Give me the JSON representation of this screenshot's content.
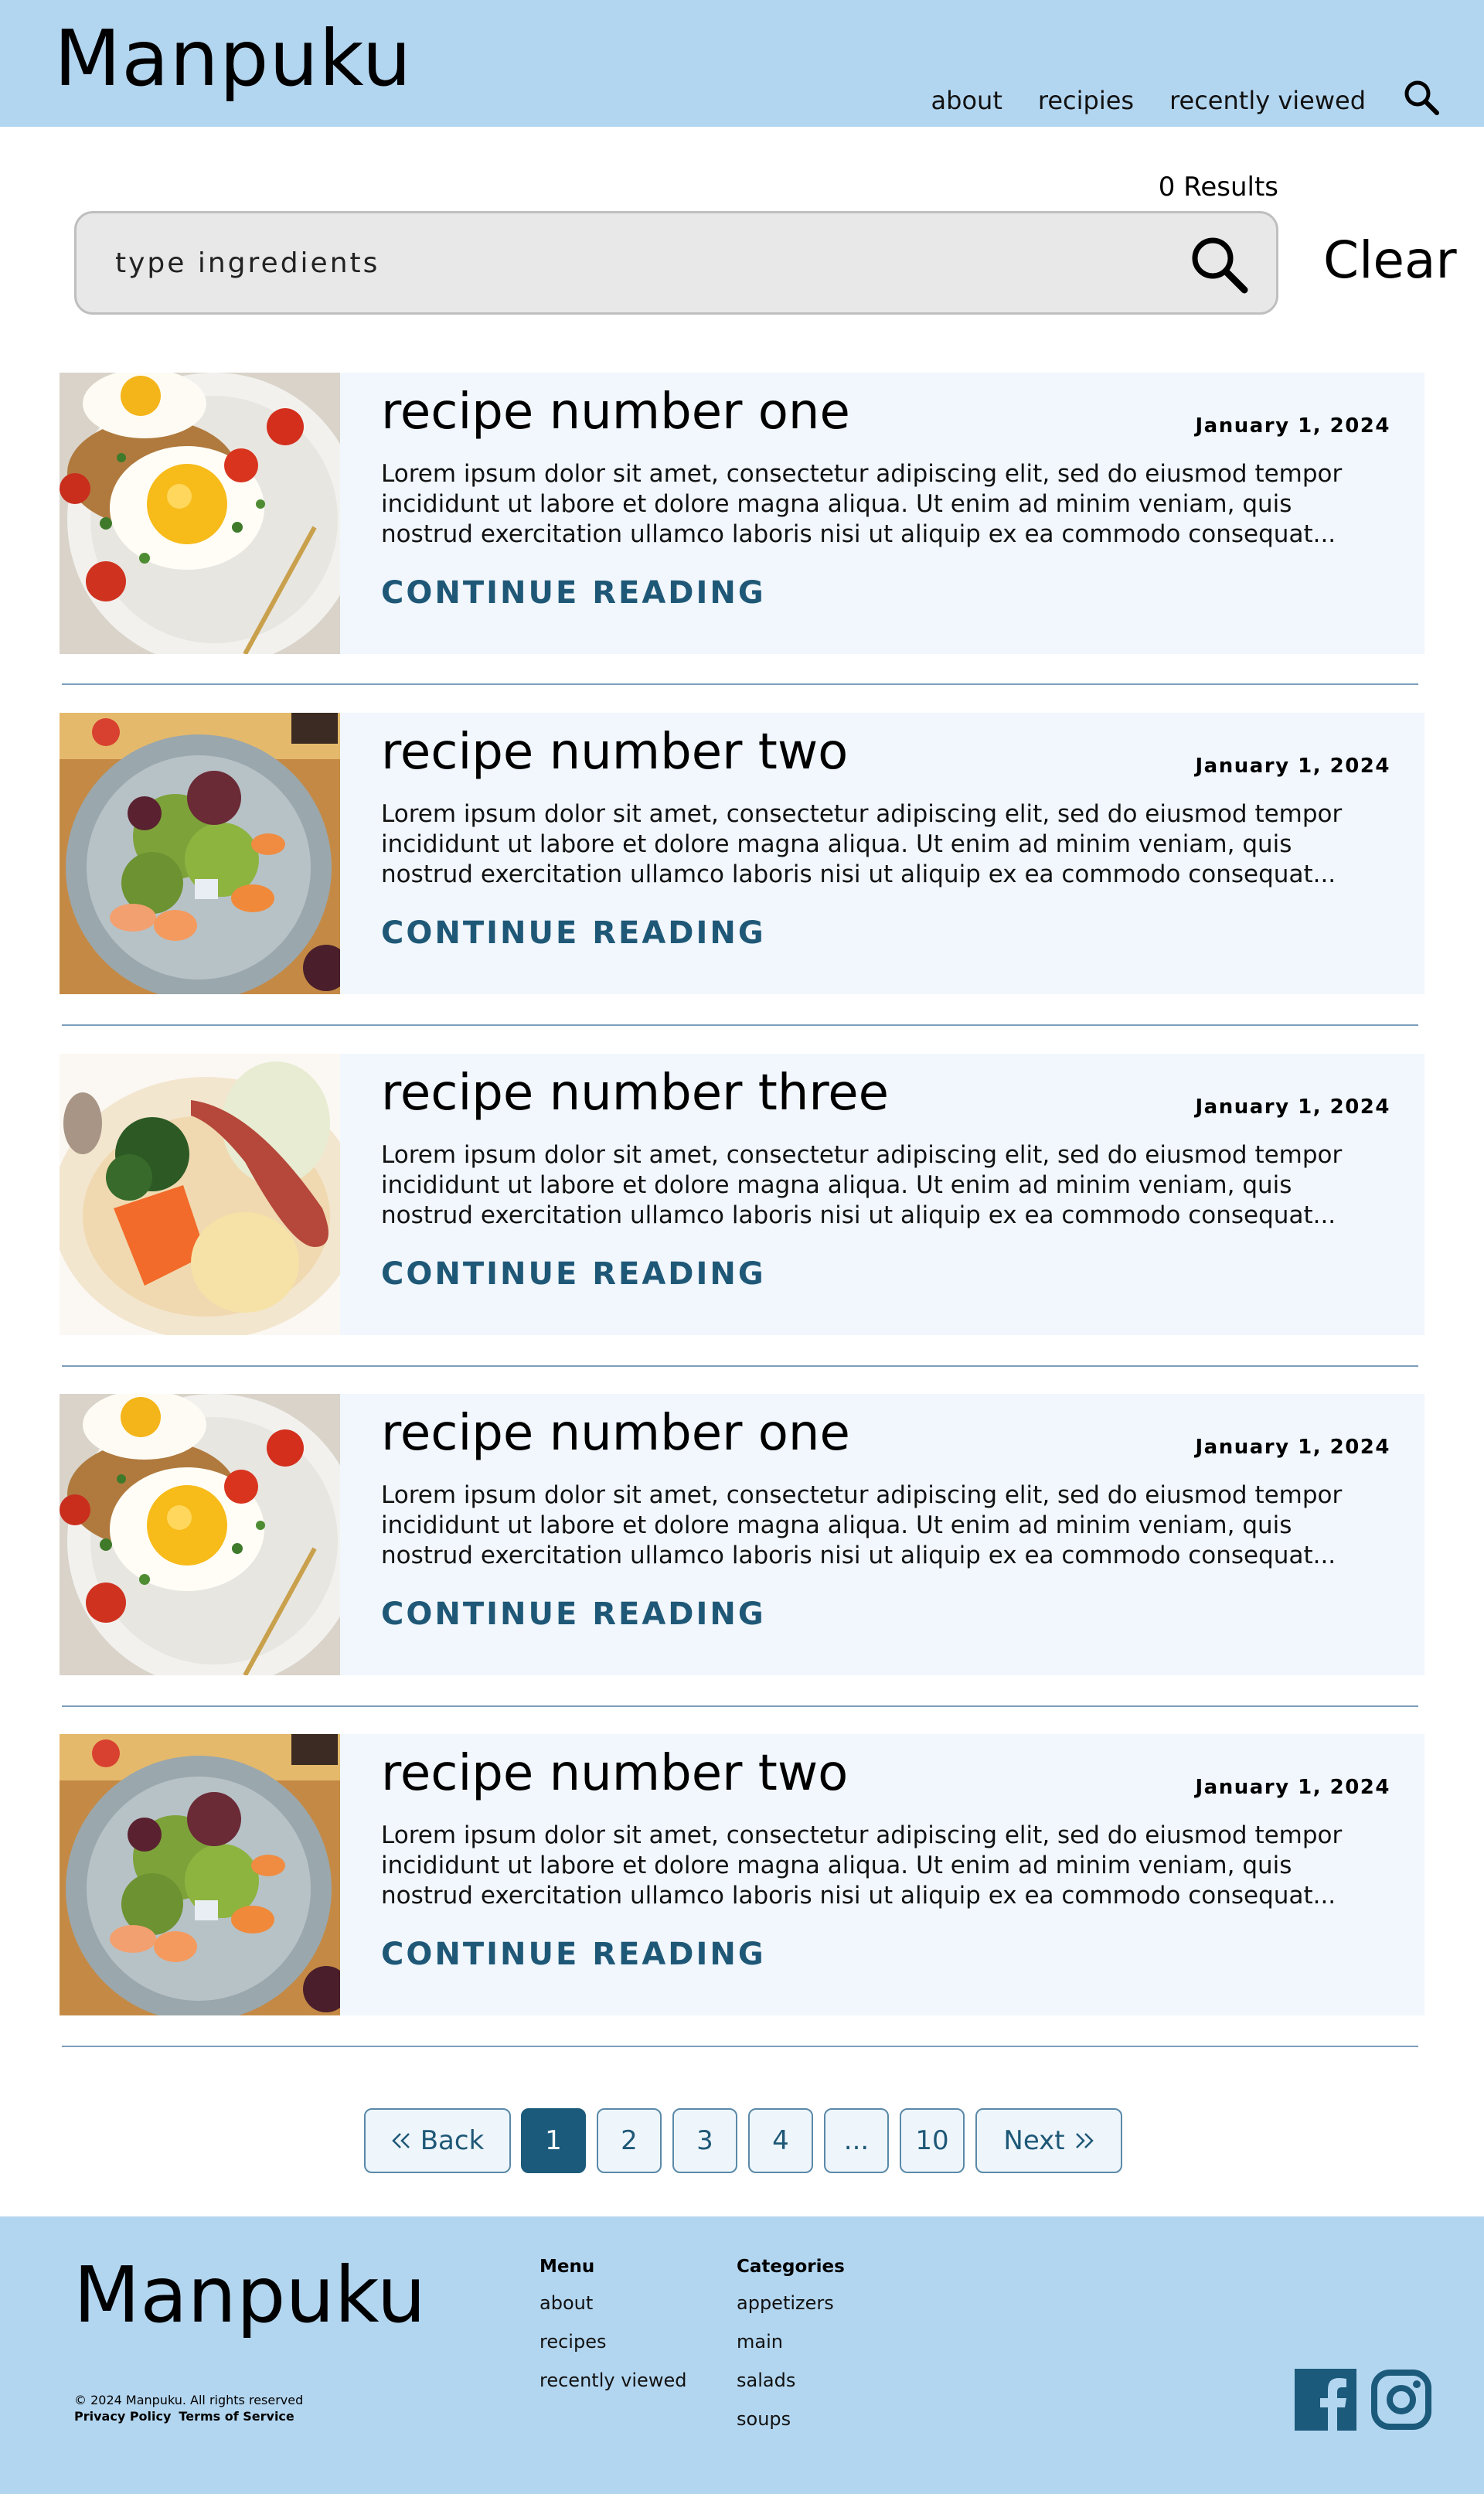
{
  "header": {
    "logo": "Manpuku",
    "nav": [
      "about",
      "recipies",
      "recently viewed"
    ]
  },
  "search": {
    "results": "0 Results",
    "placeholder": "type ingredients",
    "clear_label": "Clear"
  },
  "recipes": [
    {
      "title": "recipe number one",
      "date": "January 1, 2024",
      "excerpt": "Lorem ipsum dolor sit amet, consectetur adipiscing elit, sed do eiusmod tempor incididunt ut labore et dolore magna aliqua. Ut enim ad minim veniam, quis nostrud exercitation ullamco laboris nisi ut aliquip ex ea commodo consequat...",
      "cta": "CONTINUE READING",
      "image": "fried-egg-plate"
    },
    {
      "title": "recipe number two",
      "date": "January 1, 2024",
      "excerpt": "Lorem ipsum dolor sit amet, consectetur adipiscing elit, sed do eiusmod tempor incididunt ut labore et dolore magna aliqua. Ut enim ad minim veniam, quis nostrud exercitation ullamco laboris nisi ut aliquip ex ea commodo consequat...",
      "cta": "CONTINUE READING",
      "image": "salad-plate"
    },
    {
      "title": "recipe number three",
      "date": "January 1, 2024",
      "excerpt": "Lorem ipsum dolor sit amet, consectetur adipiscing elit, sed do eiusmod tempor incididunt ut labore et dolore magna aliqua. Ut enim ad minim veniam, quis nostrud exercitation ullamco laboris nisi ut aliquip ex ea commodo consequat...",
      "cta": "CONTINUE READING",
      "image": "vegetable-soup"
    },
    {
      "title": "recipe number one",
      "date": "January 1, 2024",
      "excerpt": "Lorem ipsum dolor sit amet, consectetur adipiscing elit, sed do eiusmod tempor incididunt ut labore et dolore magna aliqua. Ut enim ad minim veniam, quis nostrud exercitation ullamco laboris nisi ut aliquip ex ea commodo consequat...",
      "cta": "CONTINUE READING",
      "image": "fried-egg-plate"
    },
    {
      "title": "recipe number two",
      "date": "January 1, 2024",
      "excerpt": "Lorem ipsum dolor sit amet, consectetur adipiscing elit, sed do eiusmod tempor incididunt ut labore et dolore magna aliqua. Ut enim ad minim veniam, quis nostrud exercitation ullamco laboris nisi ut aliquip ex ea commodo consequat...",
      "cta": "CONTINUE READING",
      "image": "salad-plate"
    }
  ],
  "pagination": {
    "back": "Back",
    "next": "Next",
    "pages": [
      "1",
      "2",
      "3",
      "4",
      "...",
      "10"
    ],
    "current": "1"
  },
  "footer": {
    "logo": "Manpuku",
    "copyright": "© 2024 Manpuku. All rights reserved",
    "privacy": "Privacy Policy",
    "terms": "Terms of Service",
    "menu_heading": "Menu",
    "menu": [
      "about",
      "recipes",
      "recently viewed"
    ],
    "categories_heading": "Categories",
    "categories": [
      "appetizers",
      "main",
      "salads",
      "soups"
    ],
    "social": [
      "facebook-icon",
      "instagram-icon"
    ]
  },
  "colors": {
    "header_bg": "#b3d6f0",
    "card_bg": "#f1f7fd",
    "accent": "#1f5877",
    "divider": "#7d9fbd"
  }
}
